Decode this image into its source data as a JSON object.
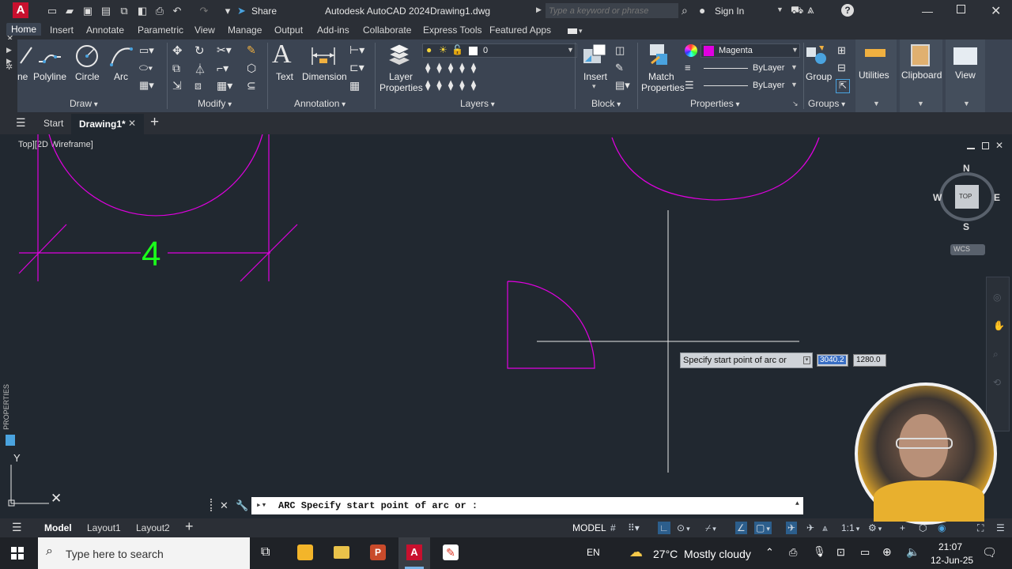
{
  "app": {
    "title": "Autodesk AutoCAD 2024",
    "filename": "Drawing1.dwg",
    "app_logo": "A"
  },
  "titlebar": {
    "share": "Share",
    "search_placeholder": "Type a keyword or phrase",
    "sign_in": "Sign In"
  },
  "ribbon_tabs": [
    "Home",
    "Insert",
    "Annotate",
    "Parametric",
    "View",
    "Manage",
    "Output",
    "Add-ins",
    "Collaborate",
    "Express Tools",
    "Featured Apps"
  ],
  "ribbon": {
    "draw": {
      "label": "Draw",
      "line": "ne",
      "polyline": "Polyline",
      "circle": "Circle",
      "arc": "Arc"
    },
    "modify": {
      "label": "Modify"
    },
    "annotation": {
      "label": "Annotation",
      "text": "Text",
      "dimension": "Dimension"
    },
    "layers": {
      "label": "Layers",
      "layer_properties_1": "Layer",
      "layer_properties_2": "Properties",
      "current_layer": "0"
    },
    "block": {
      "label": "Block",
      "insert": "Insert"
    },
    "properties": {
      "label": "Properties",
      "match_1": "Match",
      "match_2": "Properties",
      "color": "Magenta",
      "linetype": "ByLayer",
      "lineweight": "ByLayer",
      "color_swatch": "#e000e0"
    },
    "groups": {
      "label": "Groups",
      "group": "Group"
    },
    "utilities": "Utilities",
    "clipboard": "Clipboard",
    "view": "View"
  },
  "file_tabs": {
    "start": "Start",
    "drawing": "Drawing1*"
  },
  "viewport": {
    "label": "Top][2D Wireframe]",
    "dimension_text": "4",
    "viewcube": {
      "n": "N",
      "s": "S",
      "e": "E",
      "w": "W",
      "top": "TOP",
      "wcs": "WCS"
    },
    "tooltip": "Specify start point of arc or",
    "coord_x": "3040.2",
    "coord_y": "1280.0",
    "properties_palette": "PROPERTIES",
    "ucs_y": "Y"
  },
  "command_line": {
    "text": "ARC Specify start point of arc or :"
  },
  "layout_tabs": [
    "Model",
    "Layout1",
    "Layout2"
  ],
  "status": {
    "model": "MODEL",
    "scale": "1:1"
  },
  "taskbar": {
    "search_placeholder": "Type here to search",
    "lang": "EN",
    "weather": "27°C  Mostly cloudy",
    "time": "21:07",
    "date": "12-Jun-25"
  },
  "colors": {
    "magenta": "#e000e0",
    "dimension_green": "#1aff1a",
    "accent": "#0d6ebd"
  }
}
